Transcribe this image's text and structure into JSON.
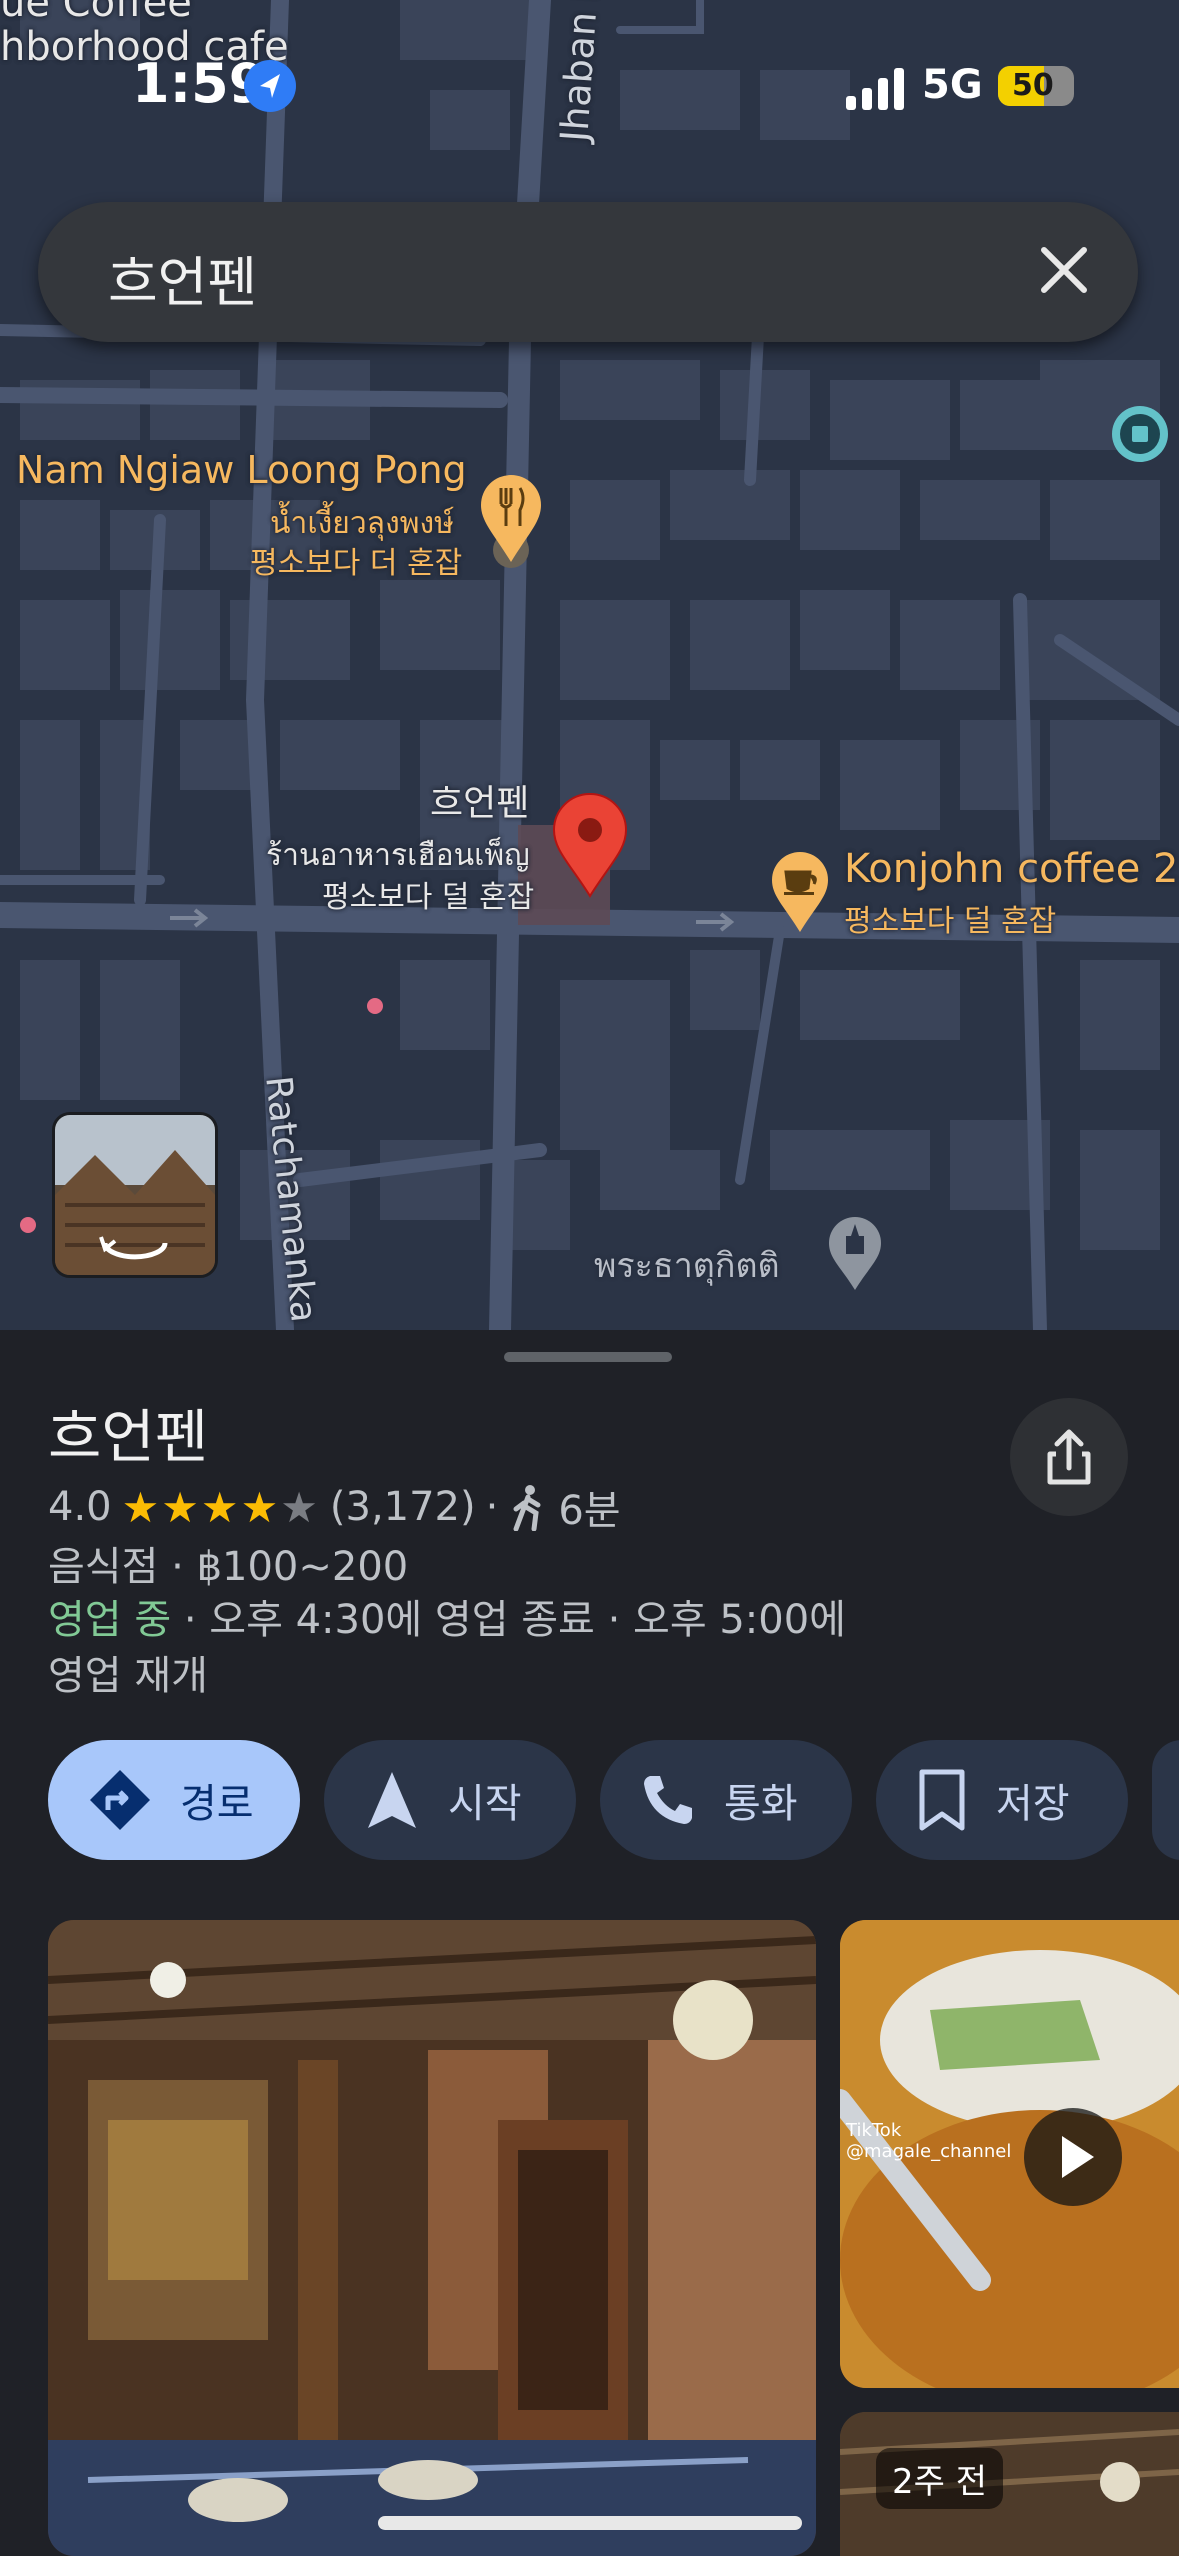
{
  "status": {
    "time": "1:59",
    "network": "5G",
    "battery": "50"
  },
  "search": {
    "query": "흐언펜"
  },
  "map": {
    "top_labels": [
      "ue Coffee",
      "hborhood cafe"
    ],
    "road_jhaban": "Jhaban Rd",
    "road_ratchamanka": "Ratchamanka",
    "poi_nam_en": "Nam Ngiaw Loong Pong",
    "poi_nam_th": "น้ำเงี้ยวลุงพงษ์",
    "poi_nam_ko": "평소보다 더 혼잡",
    "place_ko": "흐언펜",
    "place_th": "ร้านอาหารเฮือนเพ็ญ",
    "place_busy": "평소보다 덜 혼잡",
    "poi_konjohn": "Konjohn coffee 2",
    "poi_konjohn_busy": "평소보다 덜 혼잡",
    "poi_temple": "พระธาตุกิตติ"
  },
  "place": {
    "name": "흐언펜",
    "rating": "4.0",
    "stars_filled": 4,
    "stars_total": 5,
    "reviews": "(3,172)",
    "walk_time": "6분",
    "category": "음식점",
    "price": "฿100~200",
    "open_status": "영업 중",
    "closes": "오후 4:30에 영업 종료",
    "reopens_line1": "오후 5:00에",
    "reopens_line2": "영업 재개"
  },
  "actions": {
    "directions": "경로",
    "start": "시작",
    "call": "통화",
    "save": "저장"
  },
  "photos": {
    "tiktok": "TikTok",
    "tiktok_user": "@magale_channel",
    "ago": "2주 전"
  },
  "colors": {
    "accent_blue": "#a8c7fa",
    "open_green": "#81c995",
    "star": "#fbbc04",
    "pin_red": "#ea4335",
    "poi_orange": "#f6b85f"
  }
}
